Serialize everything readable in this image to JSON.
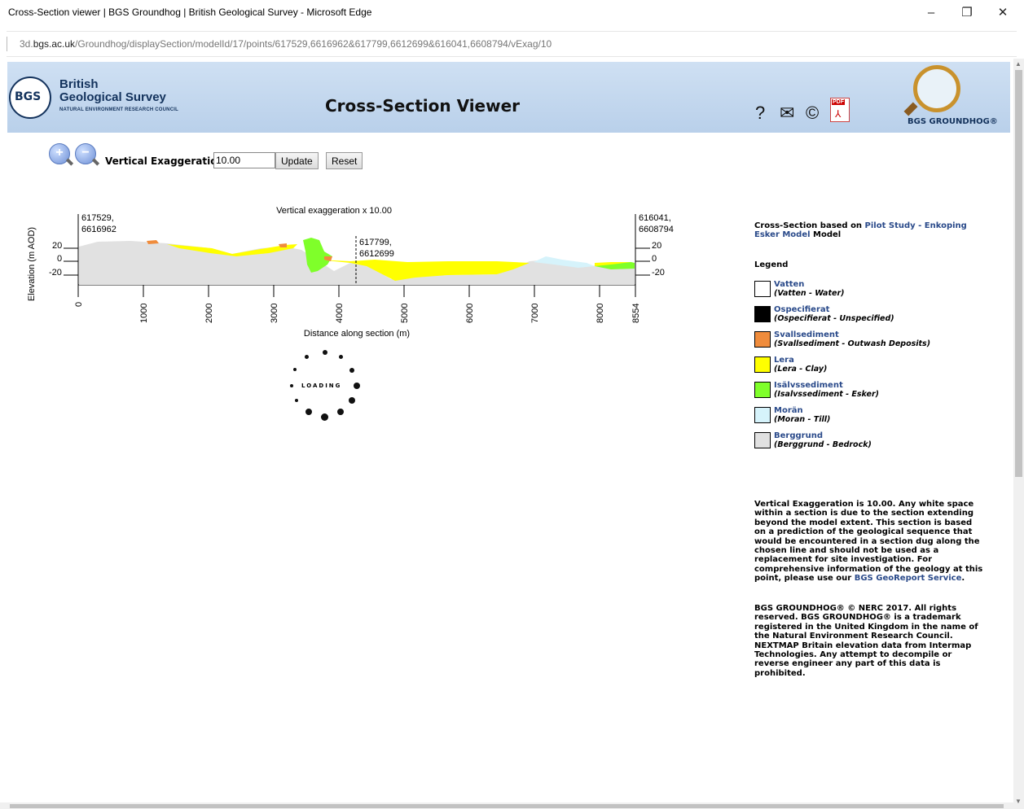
{
  "window": {
    "title": "Cross-Section viewer | BGS Groundhog | British Geological Survey - Microsoft Edge",
    "minimize": "–",
    "restore": "❐",
    "close": "✕"
  },
  "address": {
    "domain_prefix": "3d.",
    "domain": "bgs.ac.uk",
    "path": "/Groundhog/displaySection/modelId/17/points/617529,6616962&617799,6612699&616041,6608794/vExag/10"
  },
  "header": {
    "logo_mark": "BGS",
    "logo_line1": "British",
    "logo_line2": "Geological Survey",
    "logo_sub": "NATURAL ENVIRONMENT RESEARCH COUNCIL",
    "title": "Cross-Section Viewer",
    "groundhog_brand": "BGS GROUNDHOG®",
    "pdf_badge": "PDF"
  },
  "toolbar": {
    "zoom_in": "+",
    "zoom_out": "−",
    "vex_label": "Vertical Exaggeration",
    "vex_value": "10.00",
    "update_label": "Update",
    "reset_label": "Reset"
  },
  "section": {
    "caption": "Vertical exaggeration  x 10.00",
    "y_axis_label": "Elevation (m AOD)",
    "x_axis_label": "Distance along section (m)",
    "start_point": [
      "617529,",
      "6616962"
    ],
    "mid_point": [
      "617799,",
      "6612699"
    ],
    "end_point": [
      "616041,",
      "6608794"
    ],
    "left_ticks": [
      "20",
      "0",
      "-20"
    ],
    "right_ticks": [
      "20",
      "0",
      "-20"
    ],
    "x_ticks": [
      "0",
      "1000",
      "2000",
      "3000",
      "4000",
      "5000",
      "6000",
      "7000",
      "8000",
      "8554"
    ],
    "loading_text": "LOADING"
  },
  "right_panel": {
    "based_prefix": "Cross-Section based on ",
    "model_link": "Pilot Study - Enkoping Esker Model",
    "based_suffix": " Model",
    "legend_title": "Legend",
    "legend": [
      {
        "name": "Vatten",
        "desc": "(Vatten - Water)",
        "color": "#ffffff"
      },
      {
        "name": "Ospecifierat",
        "desc": "(Ospecifierat - Unspecified)",
        "color": "#000000"
      },
      {
        "name": "Svallsediment",
        "desc": "(Svallsediment - Outwash Deposits)",
        "color": "#f08c3c"
      },
      {
        "name": "Lera",
        "desc": "(Lera - Clay)",
        "color": "#ffff00"
      },
      {
        "name": "Isälvssediment",
        "desc": "(Isalvssediment - Esker)",
        "color": "#7fff2a"
      },
      {
        "name": "Morän",
        "desc": "(Moran - Till)",
        "color": "#d6f3fb"
      },
      {
        "name": "Berggrund",
        "desc": "(Berggrund - Bedrock)",
        "color": "#e1e1e1"
      }
    ],
    "notice1": "Vertical Exaggeration is 10.00. Any white space within a section is due to the section extending beyond the model extent. This section is based on a prediction of the geological sequence that would be encountered in a section dug along the chosen line and should not be used as a replacement for site investigation. For comprehensive information of the geology at this point, please use our ",
    "notice1_link": "BGS GeoReport Service",
    "notice1_end": ".",
    "notice2": "BGS GROUNDHOG® © NERC 2017. All rights reserved. BGS GROUNDHOG® is a trademark registered in the United Kingdom in the name of the Natural Environment Research Council. NEXTMAP Britain elevation data from Intermap Technologies. Any attempt to decompile or reverse engineer any part of this data is prohibited."
  }
}
